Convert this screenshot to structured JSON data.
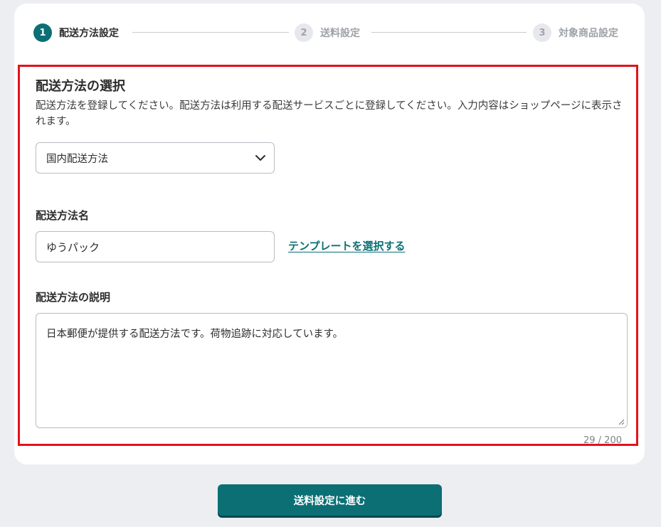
{
  "stepper": {
    "steps": [
      {
        "number": "1",
        "label": "配送方法設定",
        "state": "active"
      },
      {
        "number": "2",
        "label": "送料設定",
        "state": "inactive"
      },
      {
        "number": "3",
        "label": "対象商品設定",
        "state": "inactive"
      }
    ]
  },
  "shipping_method": {
    "title": "配送方法の選択",
    "description": "配送方法を登録してください。配送方法は利用する配送サービスごとに登録してください。入力内容はショップページに表示されます。",
    "selected": "国内配送方法",
    "chevron_icon": "chevron-down-icon"
  },
  "method_name": {
    "title": "配送方法名",
    "value": "ゆうパック",
    "template_link": "テンプレートを選択する"
  },
  "method_description": {
    "title": "配送方法の説明",
    "value": "日本郵便が提供する配送方法です。荷物追跡に対応しています。",
    "counter": "29 / 200"
  },
  "footer": {
    "next_button": "送料設定に進む"
  },
  "colors": {
    "accent": "#0b6f74",
    "highlight_border": "#e3121b",
    "background": "#eceef2"
  }
}
